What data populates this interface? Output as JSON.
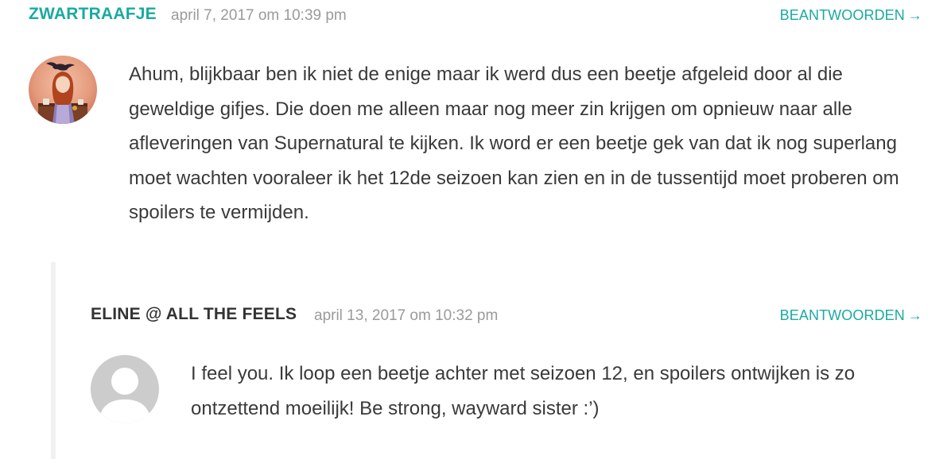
{
  "comments": [
    {
      "author": "ZWARTRAAFJE",
      "timestamp": "april 7, 2017 om 10:39 pm",
      "reply_label": "BEANTWOORDEN",
      "reply_arrow": "→",
      "avatar_icon": "illustrated-avatar-girl-with-raven",
      "author_color": "#1aaaa2",
      "text": "Ahum, blijkbaar ben ik niet de enige maar ik werd dus een beetje afgeleid door al die geweldige gifjes. Die doen me alleen maar nog meer zin krijgen om opnieuw naar alle afleveringen van Supernatural te kijken. Ik word er een beetje gek van dat ik nog superlang moet wachten vooraleer ik het 12de seizoen kan zien en in de tussentijd moet proberen om spoilers te vermijden."
    },
    {
      "author": "ELINE @ ALL THE FEELS",
      "timestamp": "april 13, 2017 om 10:32 pm",
      "reply_label": "BEANTWOORDEN",
      "reply_arrow": "→",
      "avatar_icon": "default-person-avatar-icon",
      "author_color": "#333333",
      "text": "I feel you. Ik loop een beetje achter met seizoen 12, en spoilers ontwijken is zo ontzettend moeilijk! Be strong, wayward sister :’)"
    }
  ],
  "colors": {
    "accent": "#1aaaa2",
    "muted": "#9a9a9a",
    "body_text": "#3a3a3a"
  }
}
